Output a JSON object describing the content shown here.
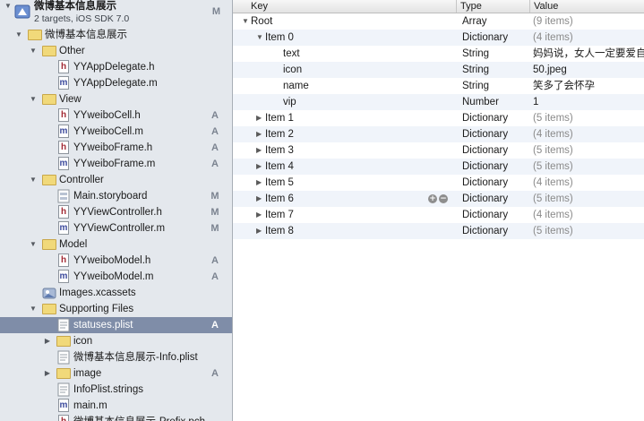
{
  "project": {
    "title": "微博基本信息展示",
    "subtitle": "2 targets, iOS SDK 7.0",
    "badge": "M"
  },
  "navigator": [
    {
      "label": "微博基本信息展示",
      "kind": "folder",
      "indent": 1,
      "expanded": true,
      "badge": ""
    },
    {
      "label": "Other",
      "kind": "folder",
      "indent": 2,
      "expanded": true,
      "badge": ""
    },
    {
      "label": "YYAppDelegate.h",
      "kind": "h",
      "indent": 3,
      "badge": ""
    },
    {
      "label": "YYAppDelegate.m",
      "kind": "m",
      "indent": 3,
      "badge": ""
    },
    {
      "label": "View",
      "kind": "folder",
      "indent": 2,
      "expanded": true,
      "badge": ""
    },
    {
      "label": "YYweiboCell.h",
      "kind": "h",
      "indent": 3,
      "badge": "A"
    },
    {
      "label": "YYweiboCell.m",
      "kind": "m",
      "indent": 3,
      "badge": "A"
    },
    {
      "label": "YYweiboFrame.h",
      "kind": "h",
      "indent": 3,
      "badge": "A"
    },
    {
      "label": "YYweiboFrame.m",
      "kind": "m",
      "indent": 3,
      "badge": "A"
    },
    {
      "label": "Controller",
      "kind": "folder",
      "indent": 2,
      "expanded": true,
      "badge": ""
    },
    {
      "label": "Main.storyboard",
      "kind": "storyboard",
      "indent": 3,
      "badge": "M"
    },
    {
      "label": "YYViewController.h",
      "kind": "h",
      "indent": 3,
      "badge": "M"
    },
    {
      "label": "YYViewController.m",
      "kind": "m",
      "indent": 3,
      "badge": "M"
    },
    {
      "label": "Model",
      "kind": "folder",
      "indent": 2,
      "expanded": true,
      "badge": ""
    },
    {
      "label": "YYweiboModel.h",
      "kind": "h",
      "indent": 3,
      "badge": "A"
    },
    {
      "label": "YYweiboModel.m",
      "kind": "m",
      "indent": 3,
      "badge": "A"
    },
    {
      "label": "Images.xcassets",
      "kind": "assets",
      "indent": 2,
      "badge": ""
    },
    {
      "label": "Supporting Files",
      "kind": "folder",
      "indent": 2,
      "expanded": true,
      "badge": ""
    },
    {
      "label": "statuses.plist",
      "kind": "plist",
      "indent": 3,
      "badge": "A",
      "selected": true
    },
    {
      "label": "icon",
      "kind": "folder",
      "indent": 3,
      "expanded": false,
      "badge": ""
    },
    {
      "label": "微博基本信息展示-Info.plist",
      "kind": "plist",
      "indent": 3,
      "badge": ""
    },
    {
      "label": "image",
      "kind": "folder",
      "indent": 3,
      "expanded": false,
      "badge": "A"
    },
    {
      "label": "InfoPlist.strings",
      "kind": "plist",
      "indent": 3,
      "badge": ""
    },
    {
      "label": "main.m",
      "kind": "m",
      "indent": 3,
      "badge": ""
    },
    {
      "label": "微博基本信息展示-Prefix.pch",
      "kind": "h",
      "indent": 3,
      "badge": ""
    }
  ],
  "editor": {
    "columns": {
      "key": "Key",
      "type": "Type",
      "value": "Value"
    },
    "rows": [
      {
        "key": "Root",
        "type": "Array",
        "value": "(9 items)",
        "level": 0,
        "disclosure": "open",
        "gray": true
      },
      {
        "key": "Item 0",
        "type": "Dictionary",
        "value": "(4 items)",
        "level": 1,
        "disclosure": "open",
        "gray": true
      },
      {
        "key": "text",
        "type": "String",
        "value": "妈妈说，女人一定要爱自己",
        "level": 2,
        "disclosure": "",
        "gray": false
      },
      {
        "key": "icon",
        "type": "String",
        "value": "50.jpeg",
        "level": 2,
        "disclosure": "",
        "gray": false
      },
      {
        "key": "name",
        "type": "String",
        "value": "笑多了会怀孕",
        "level": 2,
        "disclosure": "",
        "gray": false
      },
      {
        "key": "vip",
        "type": "Number",
        "value": "1",
        "level": 2,
        "disclosure": "",
        "gray": false
      },
      {
        "key": "Item 1",
        "type": "Dictionary",
        "value": "(5 items)",
        "level": 1,
        "disclosure": "closed",
        "gray": true
      },
      {
        "key": "Item 2",
        "type": "Dictionary",
        "value": "(4 items)",
        "level": 1,
        "disclosure": "closed",
        "gray": true
      },
      {
        "key": "Item 3",
        "type": "Dictionary",
        "value": "(5 items)",
        "level": 1,
        "disclosure": "closed",
        "gray": true
      },
      {
        "key": "Item 4",
        "type": "Dictionary",
        "value": "(5 items)",
        "level": 1,
        "disclosure": "closed",
        "gray": true
      },
      {
        "key": "Item 5",
        "type": "Dictionary",
        "value": "(4 items)",
        "level": 1,
        "disclosure": "closed",
        "gray": true
      },
      {
        "key": "Item 6",
        "type": "Dictionary",
        "value": "(5 items)",
        "level": 1,
        "disclosure": "closed",
        "gray": true,
        "hover_buttons": [
          "+",
          "−"
        ]
      },
      {
        "key": "Item 7",
        "type": "Dictionary",
        "value": "(4 items)",
        "level": 1,
        "disclosure": "closed",
        "gray": true
      },
      {
        "key": "Item 8",
        "type": "Dictionary",
        "value": "(5 items)",
        "level": 1,
        "disclosure": "closed",
        "gray": true
      }
    ]
  },
  "colors": {
    "selection": "#7f8da8",
    "navigator_bg": "#e4e8ed",
    "alt_row": "#f0f4fa",
    "folder": "#f1d97a"
  }
}
